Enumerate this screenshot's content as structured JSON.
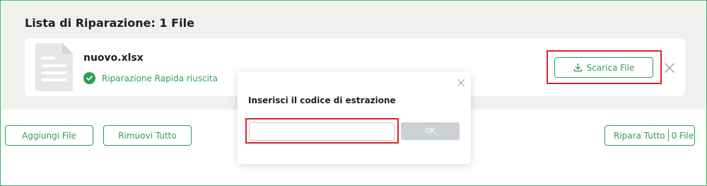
{
  "list": {
    "title": "Lista di Riparazione: 1 File"
  },
  "file": {
    "icon": "spreadsheet-file-icon",
    "name": "nuovo.xlsx",
    "status_icon": "check-circle-icon",
    "status": "Riparazione Rapida riuscita",
    "download_icon": "download-icon",
    "download_label": "Scarica File",
    "close_icon": "close-icon"
  },
  "footer": {
    "add_label": "Aggiungi File",
    "remove_label": "Rimuovi Tutto",
    "repair_label": "Ripara Tutto",
    "repair_count": "0 File"
  },
  "modal": {
    "title": "Inserisci il codice di estrazione",
    "input_value": "",
    "input_placeholder": "",
    "ok_label": "OK",
    "close_icon": "close-icon"
  },
  "colors": {
    "accent": "#2f9e57",
    "highlight": "#d9242b",
    "panel_bg": "#eef1ee",
    "disabled_btn": "#cdd1d6"
  }
}
